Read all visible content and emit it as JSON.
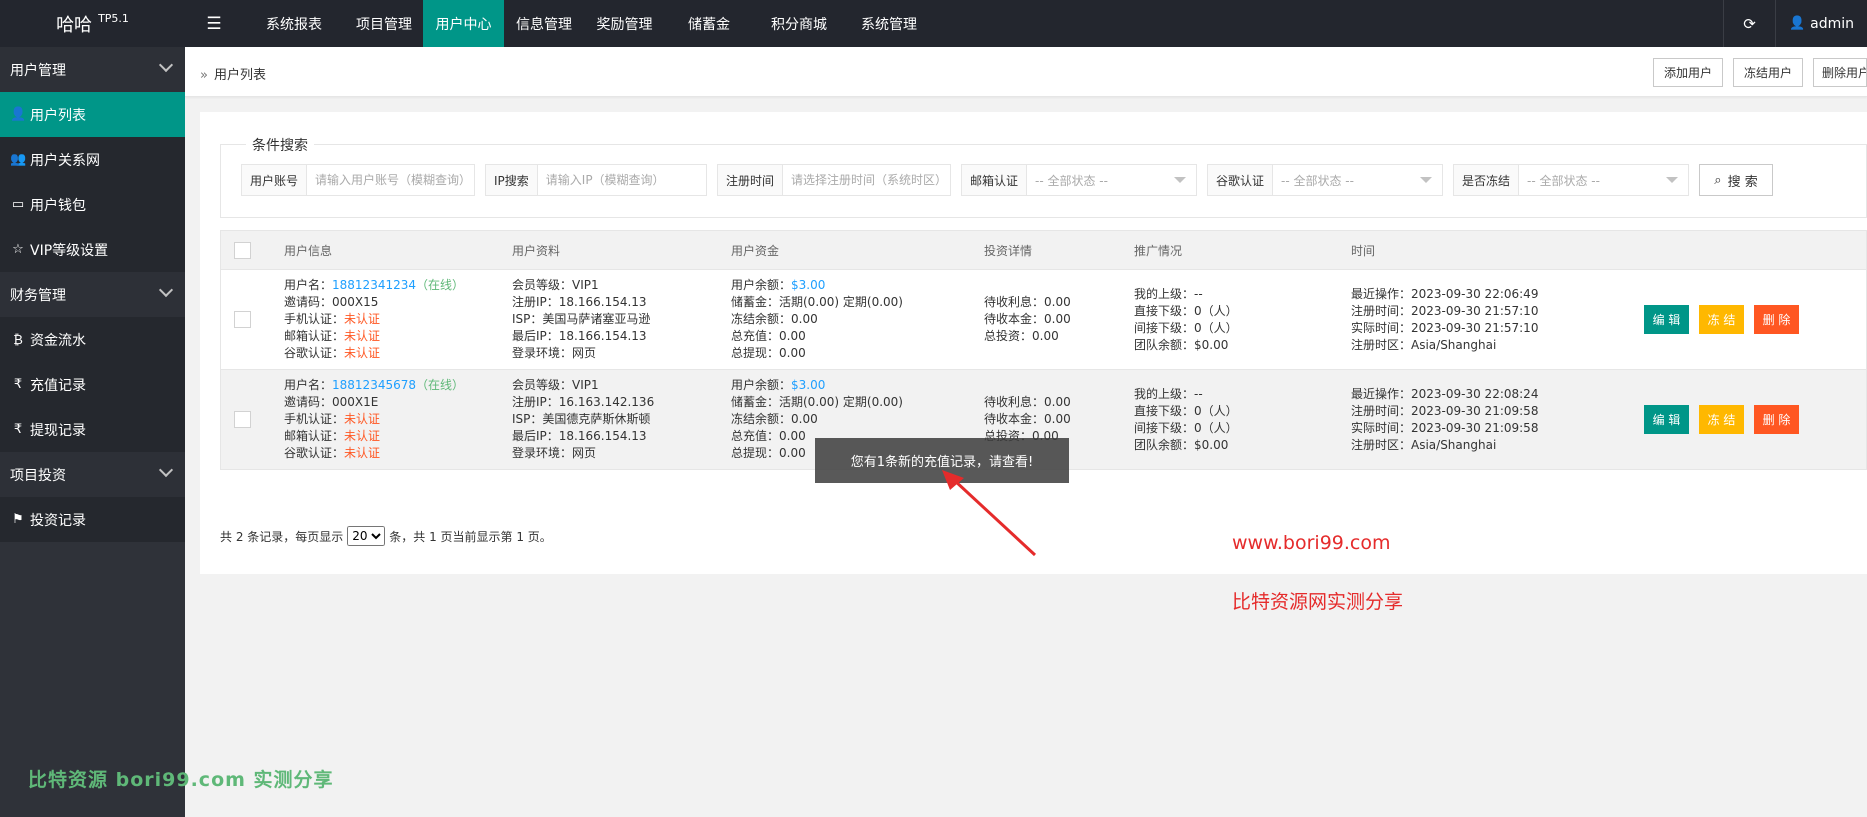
{
  "topbar": {
    "logo_title": "哈哈",
    "logo_version": "TP5.1",
    "nav": [
      "系统报表",
      "项目管理",
      "用户中心",
      "信息管理",
      "奖励管理",
      "储蓄金",
      "积分商城",
      "系统管理"
    ],
    "active_nav": "用户中心",
    "user": "admin"
  },
  "sidebar": {
    "items": [
      {
        "label": "用户管理",
        "type": "group"
      },
      {
        "label": "用户列表",
        "type": "item",
        "active": true
      },
      {
        "label": "用户关系网",
        "type": "item"
      },
      {
        "label": "用户钱包",
        "type": "item"
      },
      {
        "label": "VIP等级设置",
        "type": "item"
      },
      {
        "label": "财务管理",
        "type": "group"
      },
      {
        "label": "资金流水",
        "type": "item"
      },
      {
        "label": "充值记录",
        "type": "item"
      },
      {
        "label": "提现记录",
        "type": "item"
      },
      {
        "label": "项目投资",
        "type": "group"
      },
      {
        "label": "投资记录",
        "type": "item"
      }
    ],
    "watermark": "比特资源 bori99.com 实测分享"
  },
  "breadcrumb": "用户列表",
  "toolbar": {
    "add": "添加用户",
    "freeze": "冻结用户",
    "delete": "删除用户"
  },
  "search": {
    "legend": "条件搜索",
    "account_label": "用户账号",
    "account_placeholder": "请输入用户账号（模糊查询）",
    "ip_label": "IP搜索",
    "ip_placeholder": "请输入IP（模糊查询）",
    "time_label": "注册时间",
    "time_placeholder": "请选择注册时间（系统时区）",
    "email_label": "邮箱认证",
    "google_label": "谷歌认证",
    "frozen_label": "是否冻结",
    "all_status": "-- 全部状态 --",
    "button": "搜 索"
  },
  "table": {
    "headers": [
      "用户信息",
      "用户资料",
      "用户资金",
      "投资详情",
      "推广情况",
      "时间"
    ],
    "rows": [
      {
        "username_label": "用户名：",
        "username": "18812341234",
        "online": "（在线）",
        "invite": "邀请码：000X15",
        "phone_label": "手机认证：",
        "phone": "未认证",
        "email_label": "邮箱认证：",
        "email": "未认证",
        "google_label": "谷歌认证：",
        "google": "未认证",
        "level": "会员等级：VIP1",
        "reg_ip": "注册IP：18.166.154.13",
        "isp": "ISP：美国马萨诸塞亚马逊",
        "last_ip": "最后IP：18.166.154.13",
        "env": "登录环境：网页",
        "balance_label": "用户余额：",
        "balance": "$3.00",
        "savings": "储蓄金：活期(0.00) 定期(0.00)",
        "frozen": "冻结余额：0.00",
        "recharge": "总充值：0.00",
        "withdraw": "总提现：0.00",
        "interest": "待收利息：0.00",
        "principal": "待收本金：0.00",
        "invest": "总投资：0.00",
        "superior": "我的上级：--",
        "direct": "直接下级：0（人）",
        "indirect": "间接下级：0（人）",
        "team": "团队余额：$0.00",
        "last_op": "最近操作：2023-09-30 22:06:49",
        "reg_time": "注册时间：2023-09-30 21:57:10",
        "real_time": "实际时间：2023-09-30 21:57:10",
        "tz": "注册时区：Asia/Shanghai",
        "edit": "编 辑",
        "freeze": "冻 结",
        "delete": "删 除"
      },
      {
        "username_label": "用户名：",
        "username": "18812345678",
        "online": "（在线）",
        "invite": "邀请码：000X1E",
        "phone_label": "手机认证：",
        "phone": "未认证",
        "email_label": "邮箱认证：",
        "email": "未认证",
        "google_label": "谷歌认证：",
        "google": "未认证",
        "level": "会员等级：VIP1",
        "reg_ip": "注册IP：16.163.142.136",
        "isp": "ISP：美国德克萨斯休斯顿",
        "last_ip": "最后IP：18.166.154.13",
        "env": "登录环境：网页",
        "balance_label": "用户余额：",
        "balance": "$3.00",
        "savings": "储蓄金：活期(0.00) 定期(0.00)",
        "frozen": "冻结余额：0.00",
        "recharge": "总充值：0.00",
        "withdraw": "总提现：0.00",
        "interest": "待收利息：0.00",
        "principal": "待收本金：0.00",
        "invest": "总投资：0.00",
        "superior": "我的上级：--",
        "direct": "直接下级：0（人）",
        "indirect": "间接下级：0（人）",
        "team": "团队余额：$0.00",
        "last_op": "最近操作：2023-09-30 22:08:24",
        "reg_time": "注册时间：2023-09-30 21:09:58",
        "real_time": "实际时间：2023-09-30 21:09:58",
        "tz": "注册时区：Asia/Shanghai",
        "edit": "编 辑",
        "freeze": "冻 结",
        "delete": "删 除"
      }
    ]
  },
  "pager": {
    "before": "共 2 条记录，每页显示",
    "page_size": "20",
    "after": "条，共 1 页当前显示第 1 页。"
  },
  "toast": "您有1条新的充值记录，请查看!",
  "annotation": {
    "site": "www.bori99.com",
    "caption": "比特资源网实测分享"
  }
}
